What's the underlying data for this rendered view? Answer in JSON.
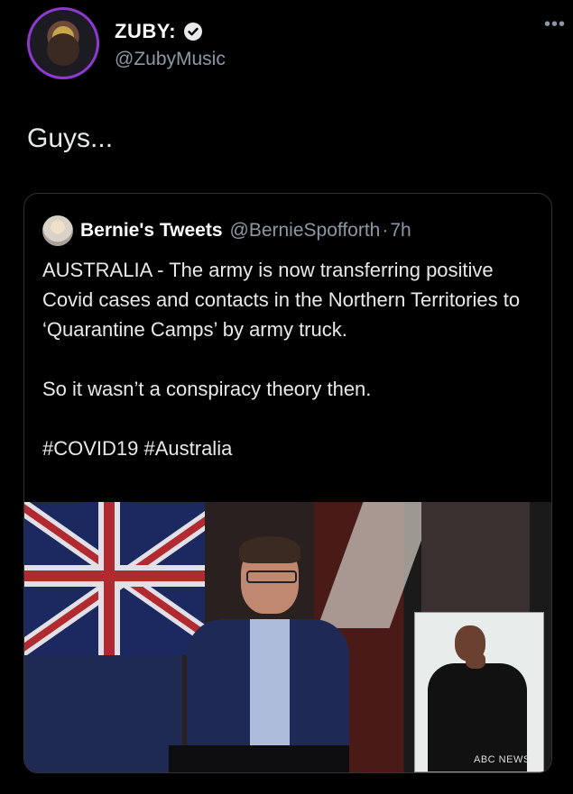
{
  "author": {
    "display_name": "ZUBY:",
    "handle": "@ZubyMusic",
    "verified_icon": "verified-badge-icon",
    "more_icon": "more-icon",
    "more_label": "•••"
  },
  "tweet": {
    "text": "Guys..."
  },
  "quoted_tweet": {
    "name": "Bernie's Tweets",
    "handle": "@BernieSpofforth",
    "separator": "·",
    "time": "7h",
    "paragraph1": "AUSTRALIA - The army is now transferring positive Covid cases and contacts in the Northern Territories to ‘Quarantine Camps’ by army truck.",
    "paragraph2": "So it wasn’t a conspiracy theory then.",
    "hashtags": "#COVID19 #Australia"
  },
  "media": {
    "watermark": "ABC NEWS"
  },
  "colors": {
    "background": "#000000",
    "text": "#e7e9ea",
    "secondary": "#8b98a5",
    "border": "#2f3336",
    "avatar_ring": "#8e3ad1"
  }
}
